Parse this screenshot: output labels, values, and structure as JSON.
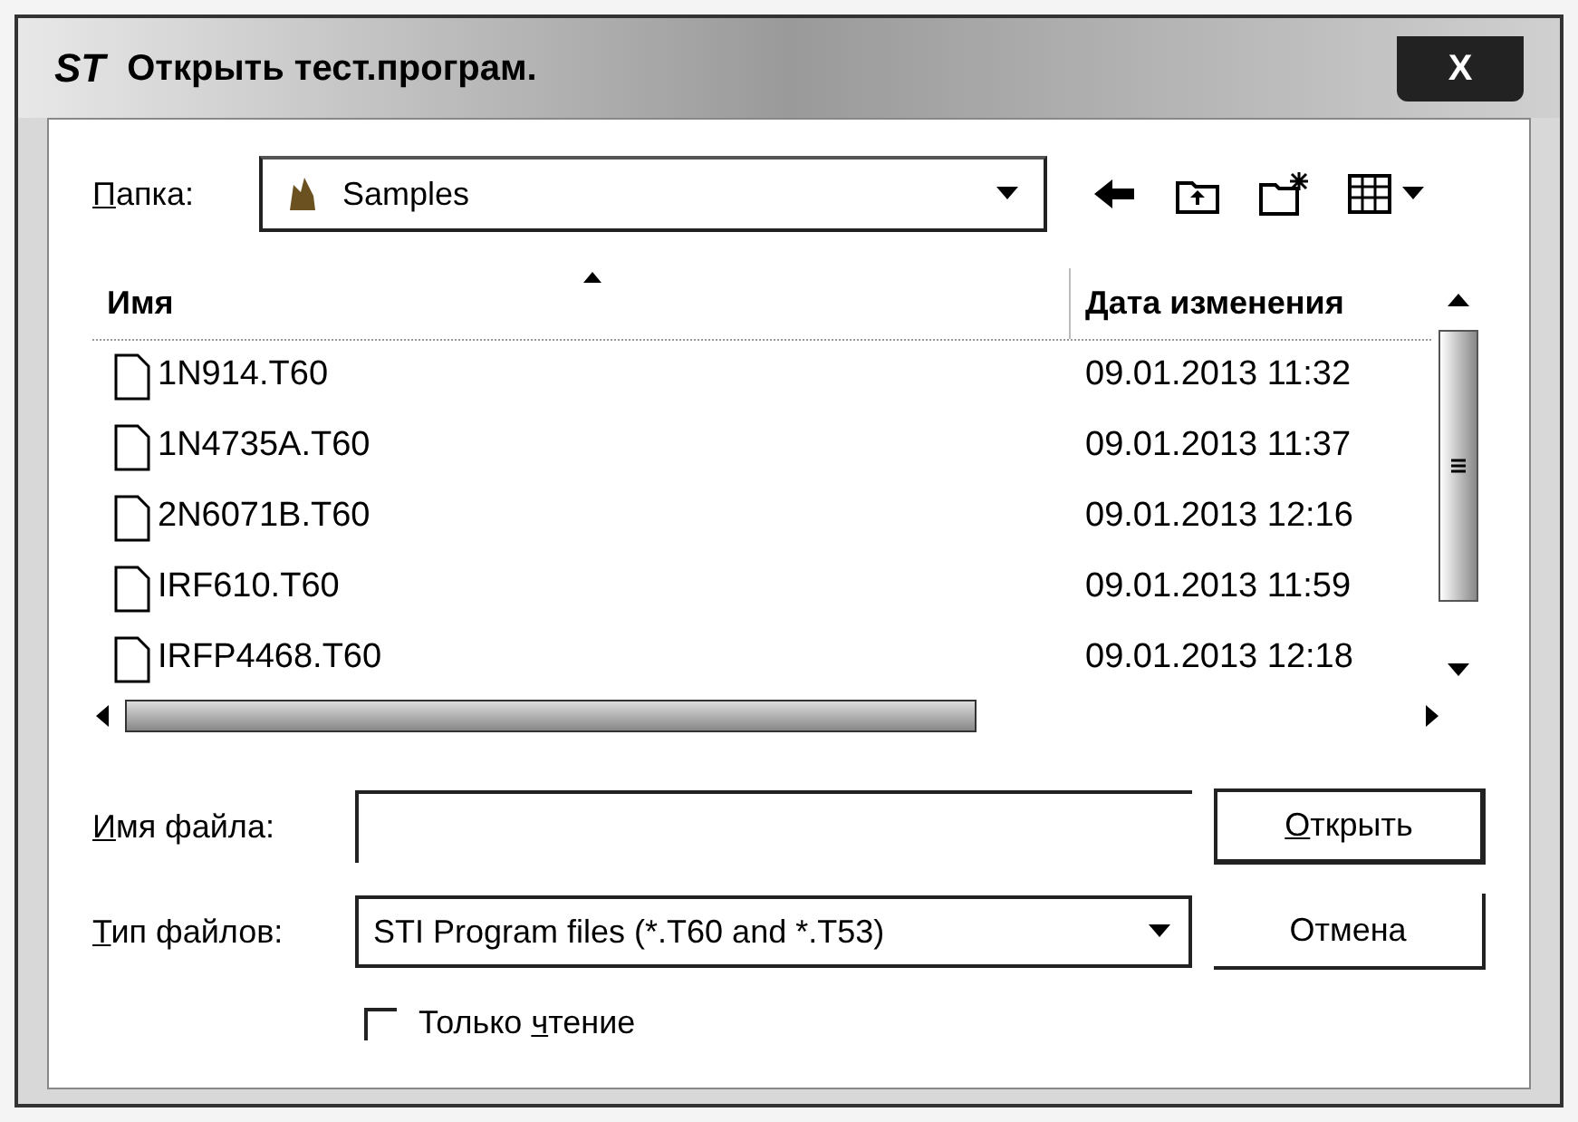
{
  "window": {
    "logo": "ST",
    "title": "Открыть тест.програм.",
    "close": "X"
  },
  "folder": {
    "label": {
      "key": "П",
      "post": "апка:"
    },
    "value": "Samples"
  },
  "columns": [
    {
      "label": "Имя",
      "sorted": true
    },
    {
      "label": "Дата изменения",
      "sorted": false
    }
  ],
  "files": [
    {
      "name": "1N914.T60",
      "date": "09.01.2013 11:32",
      "selected": false
    },
    {
      "name": "1N4735A.T60",
      "date": "09.01.2013 11:37",
      "selected": false
    },
    {
      "name": "2N6071B.T60",
      "date": "09.01.2013 12:16",
      "selected": false
    },
    {
      "name": "IRF610.T60",
      "date": "09.01.2013 11:59",
      "selected": false
    },
    {
      "name": "IRFP4468.T60",
      "date": "09.01.2013 12:18",
      "selected": false
    }
  ],
  "file_name": {
    "label": {
      "key": "И",
      "post": "мя файла:"
    }
  },
  "file_type": {
    "label": {
      "key": "Т",
      "post": "ип файлов:"
    },
    "value": "STI Program files (*.T60 and *.T53)"
  },
  "read_only": {
    "label": {
      "pre": "Только ",
      "key": "ч",
      "post": "тение"
    },
    "checked": false
  },
  "buttons": [
    {
      "label": {
        "key": "О",
        "post": "ткрыть"
      },
      "default": true
    },
    {
      "label": {
        "post": "Отмена"
      },
      "default": false
    }
  ]
}
